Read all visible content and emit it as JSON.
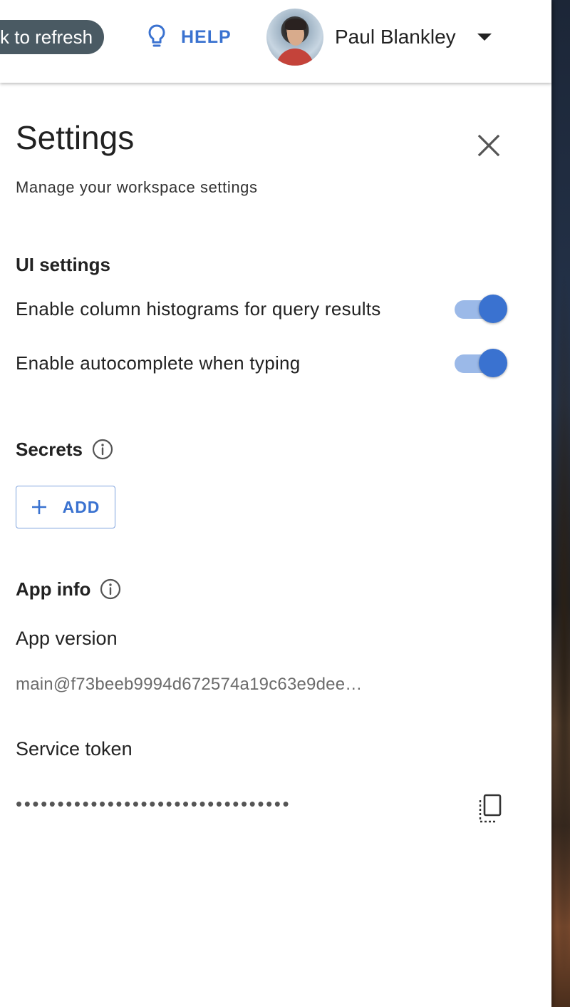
{
  "header": {
    "refresh_label": "k to refresh",
    "help_label": "HELP",
    "user_name": "Paul Blankley"
  },
  "settings": {
    "title": "Settings",
    "subtitle": "Manage your workspace settings",
    "ui_section": {
      "heading": "UI settings",
      "toggles": [
        {
          "label": "Enable column histograms for query results",
          "enabled": true
        },
        {
          "label": "Enable autocomplete when typing",
          "enabled": true
        }
      ]
    },
    "secrets_section": {
      "heading": "Secrets",
      "add_label": "ADD"
    },
    "app_info_section": {
      "heading": "App info",
      "version_label": "App version",
      "version_value": "main@f73beeb9994d672574a19c63e9dee…",
      "token_label": "Service token",
      "token_masked": "•••••••••••••••••••••••••••••••••"
    }
  },
  "icons": {
    "help": "lightbulb-icon",
    "close": "close-icon",
    "info": "info-icon",
    "add": "plus-icon",
    "copy": "copy-icon",
    "dropdown": "caret-down-icon"
  },
  "colors": {
    "accent": "#3a72d0",
    "toggle_track": "#9bb9e8",
    "refresh_pill": "#4a5a63"
  }
}
